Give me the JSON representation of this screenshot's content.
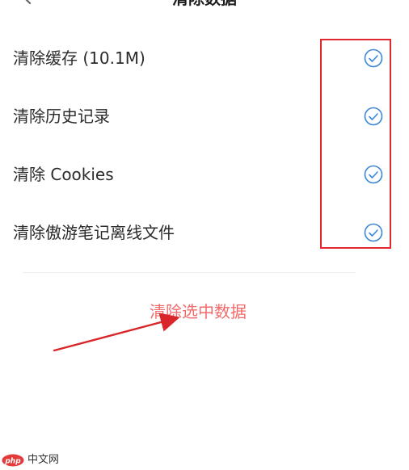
{
  "header": {
    "title": "清除数据",
    "back_icon": "chevron-left-icon"
  },
  "options": [
    {
      "label": "清除缓存 (10.1M)",
      "checked": true,
      "icon": "check-circle-icon"
    },
    {
      "label": "清除历史记录",
      "checked": true,
      "icon": "check-circle-icon"
    },
    {
      "label": "清除 Cookies",
      "checked": true,
      "icon": "check-circle-icon"
    },
    {
      "label": "清除傲游笔记离线文件",
      "checked": true,
      "icon": "check-circle-icon"
    }
  ],
  "actions": {
    "clear_selected_label": "清除选中数据"
  },
  "watermark": {
    "logo_text": "php",
    "text": "中文网"
  },
  "colors": {
    "check_blue": "#3a86d8",
    "action_red": "#f26b6b",
    "highlight_red": "#e2282c",
    "logo_red": "#e33a3a"
  }
}
